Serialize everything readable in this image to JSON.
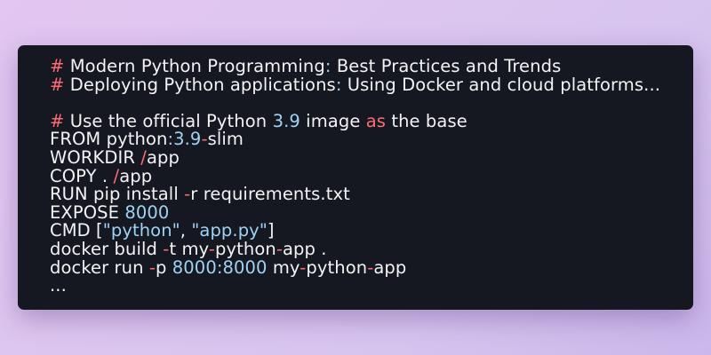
{
  "colors": {
    "background_gradient_start": "#e3c6f1",
    "background_gradient_end": "#cbb7ea",
    "window_bg": "#151820",
    "keyword_red": "#ff6b73",
    "number_blue": "#9fd3f5",
    "text_white": "#f3f3f5"
  },
  "code": {
    "lines": [
      [
        {
          "t": "#",
          "c": "red"
        },
        {
          "t": " Modern Python Programming",
          "c": "white"
        },
        {
          "t": ":",
          "c": "blue"
        },
        {
          "t": " Best Practices and Trends",
          "c": "white"
        }
      ],
      [
        {
          "t": "#",
          "c": "red"
        },
        {
          "t": " Deploying Python applications",
          "c": "white"
        },
        {
          "t": ":",
          "c": "blue"
        },
        {
          "t": " Using Docker and cloud platforms...",
          "c": "white"
        }
      ],
      [],
      [
        {
          "t": "#",
          "c": "red"
        },
        {
          "t": " Use the official Python ",
          "c": "white"
        },
        {
          "t": "3.9",
          "c": "blue"
        },
        {
          "t": " image ",
          "c": "white"
        },
        {
          "t": "as",
          "c": "red"
        },
        {
          "t": " the base",
          "c": "white"
        }
      ],
      [
        {
          "t": "FROM python",
          "c": "white"
        },
        {
          "t": ":3.9",
          "c": "blue"
        },
        {
          "t": "-",
          "c": "red"
        },
        {
          "t": "slim",
          "c": "white"
        }
      ],
      [
        {
          "t": "WORKDIR ",
          "c": "white"
        },
        {
          "t": "/",
          "c": "red"
        },
        {
          "t": "app",
          "c": "white"
        }
      ],
      [
        {
          "t": "COPY . ",
          "c": "white"
        },
        {
          "t": "/",
          "c": "red"
        },
        {
          "t": "app",
          "c": "white"
        }
      ],
      [
        {
          "t": "RUN pip install ",
          "c": "white"
        },
        {
          "t": "-",
          "c": "red"
        },
        {
          "t": "r requirements.txt",
          "c": "white"
        }
      ],
      [
        {
          "t": "EXPOSE ",
          "c": "white"
        },
        {
          "t": "8000",
          "c": "blue"
        }
      ],
      [
        {
          "t": "CMD [",
          "c": "white"
        },
        {
          "t": "\"python\"",
          "c": "blue"
        },
        {
          "t": ", ",
          "c": "white"
        },
        {
          "t": "\"app.py\"",
          "c": "blue"
        },
        {
          "t": "]",
          "c": "white"
        }
      ],
      [
        {
          "t": "docker build ",
          "c": "white"
        },
        {
          "t": "-",
          "c": "red"
        },
        {
          "t": "t my",
          "c": "white"
        },
        {
          "t": "-",
          "c": "red"
        },
        {
          "t": "python",
          "c": "white"
        },
        {
          "t": "-",
          "c": "red"
        },
        {
          "t": "app .",
          "c": "white"
        }
      ],
      [
        {
          "t": "docker run ",
          "c": "white"
        },
        {
          "t": "-",
          "c": "red"
        },
        {
          "t": "p ",
          "c": "white"
        },
        {
          "t": "8000:8000",
          "c": "blue"
        },
        {
          "t": " my",
          "c": "white"
        },
        {
          "t": "-",
          "c": "red"
        },
        {
          "t": "python",
          "c": "white"
        },
        {
          "t": "-",
          "c": "red"
        },
        {
          "t": "app",
          "c": "white"
        }
      ],
      [
        {
          "t": "...",
          "c": "white"
        }
      ]
    ]
  }
}
